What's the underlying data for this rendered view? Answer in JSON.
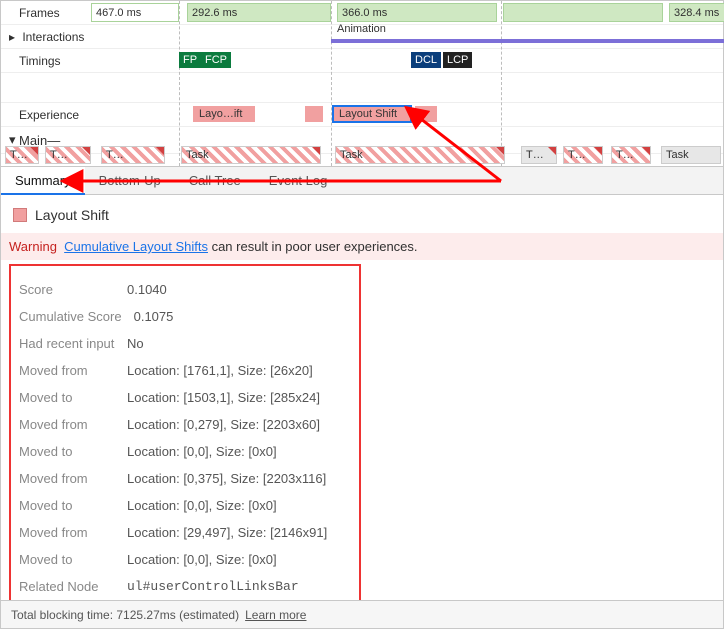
{
  "tracks": {
    "framesLabel": "Frames",
    "interactionsLabel": "Interactions",
    "timingsLabel": "Timings",
    "experienceLabel": "Experience",
    "mainLabel": "Main",
    "frames": [
      {
        "text": "467.0 ms"
      },
      {
        "text": "292.6 ms"
      },
      {
        "text": "366.0 ms"
      },
      {
        "text": "328.4 ms"
      }
    ],
    "animationLabel": "Animation",
    "timings": [
      {
        "label": "FP",
        "cls": "green"
      },
      {
        "label": "FCP",
        "cls": "green"
      },
      {
        "label": "DCL",
        "cls": "navy"
      },
      {
        "label": "LCP",
        "cls": "black"
      }
    ],
    "experienceBlocks": [
      {
        "label": "Layo…ift",
        "selected": false
      },
      {
        "label": "Layout Shift",
        "selected": true
      }
    ],
    "tasks": [
      "T…",
      "T…",
      "T…",
      "Task",
      "Task",
      "T…",
      "T…",
      "T…",
      "Task"
    ]
  },
  "tabs": [
    "Summary",
    "Bottom-Up",
    "Call Tree",
    "Event Log"
  ],
  "selectedTab": "Summary",
  "event": {
    "title": "Layout Shift",
    "warningLabel": "Warning",
    "warningLink": "Cumulative Layout Shifts",
    "warningRest": " can result in poor user experiences.",
    "details": [
      {
        "k": "Score",
        "v": "0.1040"
      },
      {
        "k": "Cumulative Score",
        "v": "0.1075"
      },
      {
        "k": "Had recent input",
        "v": "No"
      },
      {
        "k": "Moved from",
        "v": "Location: [1761,1], Size: [26x20]"
      },
      {
        "k": "Moved to",
        "v": "Location: [1503,1], Size: [285x24]"
      },
      {
        "k": "Moved from",
        "v": "Location: [0,279], Size: [2203x60]"
      },
      {
        "k": "Moved to",
        "v": "Location: [0,0], Size: [0x0]"
      },
      {
        "k": "Moved from",
        "v": "Location: [0,375], Size: [2203x116]"
      },
      {
        "k": "Moved to",
        "v": "Location: [0,0], Size: [0x0]"
      },
      {
        "k": "Moved from",
        "v": "Location: [29,497], Size: [2146x91]"
      },
      {
        "k": "Moved to",
        "v": "Location: [0,0], Size: [0x0]"
      },
      {
        "k": "Related Node",
        "v": "ul#userControlLinksBar",
        "mono": true
      }
    ]
  },
  "footer": {
    "text": "Total blocking time: 7125.27ms (estimated)",
    "link": "Learn more"
  }
}
